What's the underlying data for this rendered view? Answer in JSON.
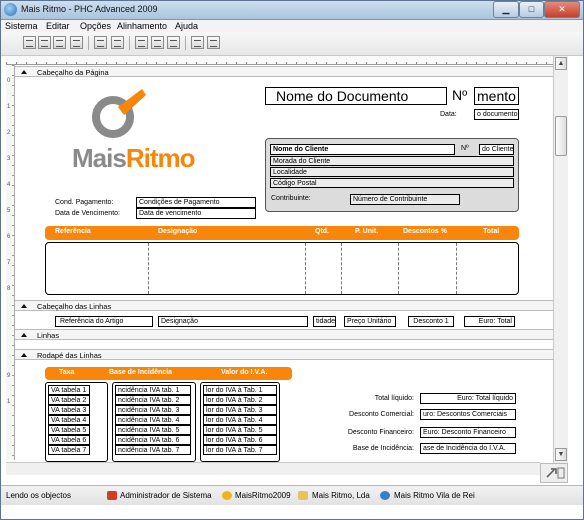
{
  "window": {
    "title": "Mais Ritmo - PHC Advanced 2009",
    "minimize": "▁",
    "maximize": "□",
    "close": "✕"
  },
  "menu": [
    "Sistema",
    "Editar",
    "Opções",
    "Alinhamento",
    "Ajuda"
  ],
  "sections": {
    "header": "Cabeçalho da Página",
    "lines_header": "Cabeçalho das Linhas",
    "lines": "Linhas",
    "footer": "Rodapé das Linhas"
  },
  "logo": {
    "text_gray": "Mais",
    "text_orange": "Ritmo",
    "colors": {
      "gray": "#8a8a8a",
      "orange": "#f7860a"
    }
  },
  "document": {
    "name": "Nome do Documento",
    "number_label": "Nº",
    "number": "mento",
    "date_label": "Data:",
    "date": "o documento"
  },
  "client": {
    "name": "Nome do Cliente",
    "number_label": "Nº",
    "number": "do Cliente",
    "address": "Morada do Cliente",
    "locality": "Localidade",
    "postcode": "Código Postal",
    "contributor_label": "Contribuinte:",
    "contributor": "Número de Contribuinte"
  },
  "payment": {
    "cond_label": "Cond. Pagamento:",
    "cond": "Condições de Pagamento",
    "due_label": "Data de Vencimento:",
    "due": "Data de vencimento"
  },
  "lines_columns": [
    "Referência",
    "Designação",
    "Qtd.",
    "P. Unit.",
    "Descontos %",
    "Total"
  ],
  "line_fields": [
    "Referência do Artigo",
    "Designação",
    "tidade",
    "Preço Unitário",
    "Desconto 1",
    "Euro: Total"
  ],
  "vat_columns": [
    "Taxa",
    "Base de Incidência",
    "Valor do I.V.A."
  ],
  "vat_rows": [
    [
      "VA tabela 1",
      "ncidência IVA tab. 1",
      "lor do IVA à Tab. 1"
    ],
    [
      "VA tabela 2",
      "ncidência IVA tab. 2",
      "lor do IVA à Tab. 2"
    ],
    [
      "VA tabela 3",
      "ncidência IVA tab. 3",
      "lor do IVA à Tab. 3"
    ],
    [
      "VA tabela 4",
      "ncidência IVA tab. 4",
      "lor do IVA à Tab. 4"
    ],
    [
      "VA tabela 5",
      "ncidência IVA tab. 5",
      "lor do IVA à Tab. 5"
    ],
    [
      "VA tabela 6",
      "ncidência IVA tab. 6",
      "lor do IVA à Tab. 6"
    ],
    [
      "VA tabela 7",
      "ncidência IVA tab. 7",
      "lor do IVA à Tab. 7"
    ]
  ],
  "totals": [
    {
      "label": "Total líquido:",
      "value": "Euro: Total líquido"
    },
    {
      "label": "Desconto Comercial:",
      "value": "uro: Descontos Comerciais"
    },
    {
      "label": "Desconto Financeiro:",
      "value": "Euro: Desconto Financeiro"
    },
    {
      "label": "Base de Incidência:",
      "value": "ase de Incidência do I.V.A."
    }
  ],
  "ruler_numbers": [
    "0",
    "1",
    "2",
    "3",
    "4",
    "5",
    "6",
    "7",
    "8",
    "9",
    "1"
  ],
  "status": {
    "left": "Lendo os objectos",
    "user": "Administrador de Sistema",
    "db": "MaisRitmo2009",
    "company": "Mais Ritmo, Lda",
    "branch": "Mais Ritmo Vila de Rei"
  }
}
